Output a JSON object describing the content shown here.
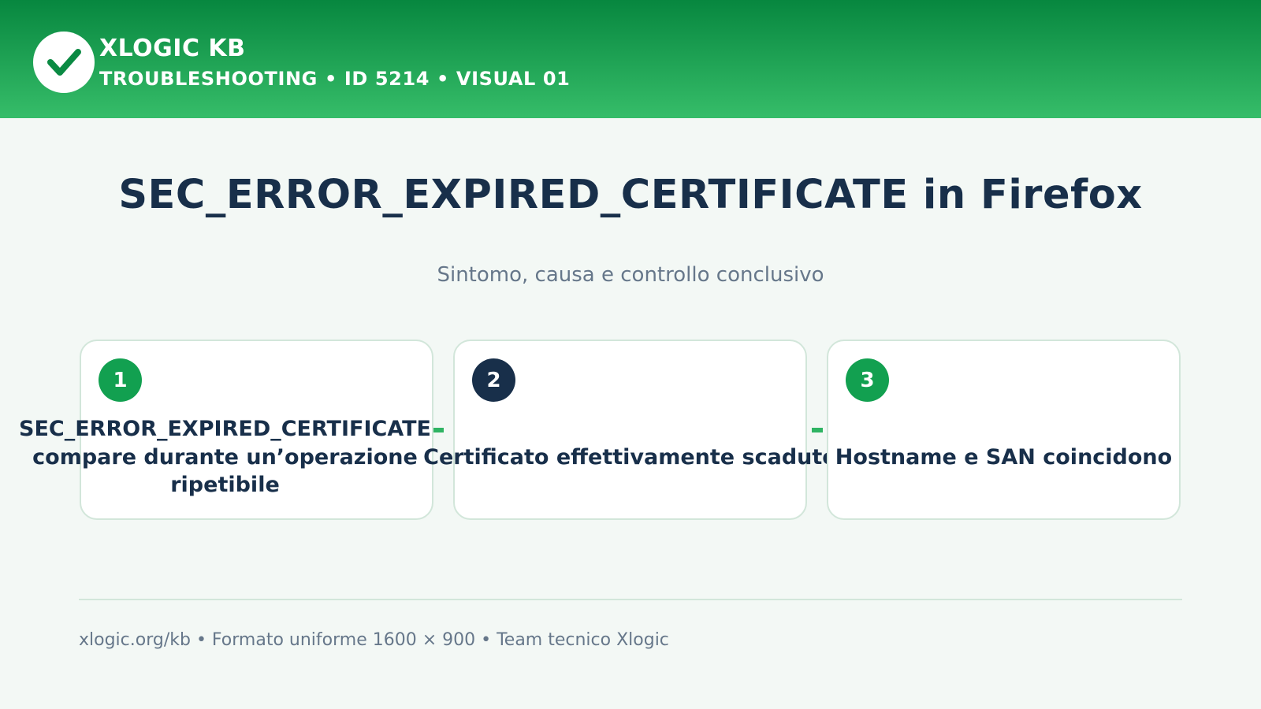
{
  "header": {
    "brand": "XLOGIC KB",
    "subtitle": "TROUBLESHOOTING • ID 5214 • VISUAL 01",
    "logo_icon": "checkmark-icon",
    "colors": {
      "gradient_top": "#07873f",
      "gradient_bottom": "#36bd69"
    }
  },
  "main": {
    "title": "SEC_ERROR_EXPIRED_CERTIFICATE in Firefox",
    "subtitle": "Sintomo, causa e controllo conclusivo"
  },
  "steps": [
    {
      "number": "1",
      "text": "“SEC_ERROR_EXPIRED_CERTIFICATE” compare durante un’operazione ripetibile",
      "badge_color": "#12a050"
    },
    {
      "number": "2",
      "text": "Certificato effettivamente scaduto",
      "badge_color": "#182f4a"
    },
    {
      "number": "3",
      "text": "Hostname e SAN coincidono",
      "badge_color": "#12a050"
    }
  ],
  "footer": {
    "text": "xlogic.org/kb • Formato uniforme 1600 × 900 • Team tecnico Xlogic"
  }
}
